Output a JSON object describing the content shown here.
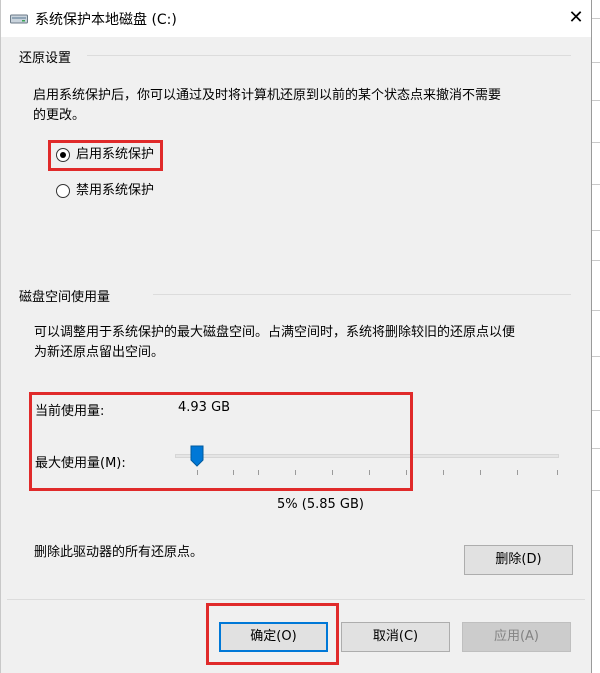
{
  "window": {
    "title": "系统保护本地磁盘 (C:)",
    "close_glyph": "✕",
    "icon": "drive-icon"
  },
  "restore_settings": {
    "group_label": "还原设置",
    "description_line1": "启用系统保护后，你可以通过及时将计算机还原到以前的某个状态点来撤消不需要",
    "description_line2": "的更改。",
    "options": [
      {
        "label": "启用系统保护",
        "selected": true
      },
      {
        "label": "禁用系统保护",
        "selected": false
      }
    ]
  },
  "disk_space": {
    "group_label": "磁盘空间使用量",
    "description_line1": "可以调整用于系统保护的最大磁盘空间。占满空间时，系统将删除较旧的还原点以便",
    "description_line2": "为新还原点留出空间。",
    "current_usage_label": "当前使用量:",
    "current_usage_value": "4.93 GB",
    "max_usage_label": "最大使用量(M):",
    "max_usage_fraction": 0.05,
    "max_usage_display": "5% (5.85 GB)"
  },
  "delete": {
    "description": "删除此驱动器的所有还原点。",
    "button_label": "删除(D)"
  },
  "buttons": {
    "ok": "确定(O)",
    "cancel": "取消(C)",
    "apply": "应用(A)"
  },
  "colors": {
    "highlight_box": "#e02a2a",
    "slider_thumb": "#0078d7",
    "dialog_bg": "#f0f0f0"
  }
}
